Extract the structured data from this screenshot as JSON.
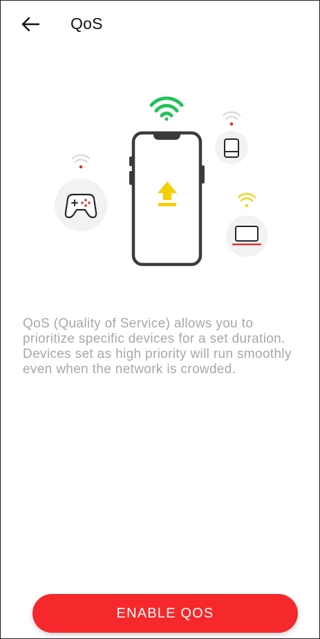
{
  "header": {
    "back_icon": "arrow-left-icon",
    "title": "QoS"
  },
  "illustration": {
    "phone_wifi_color": "#21c35a",
    "upload_arrow_color": "#f6cf00",
    "low_priority_wifi_color": "#d9d9d9",
    "low_priority_dot_color": "#e03030",
    "laptop_wifi_color": "#f2d41c",
    "device_outline_color": "#3b3b3b",
    "icons": [
      "wifi-icon",
      "smartphone-icon",
      "upload-arrow-icon",
      "tablet-icon",
      "gamepad-icon",
      "laptop-icon"
    ]
  },
  "description": {
    "text": "QoS (Quality of Service) allows you to prioritize specific devices for a set duration. Devices set as high priority will run smoothly even when the network is crowded."
  },
  "actions": {
    "enable_label": "ENABLE QOS"
  },
  "colors": {
    "accent": "#f5292b",
    "text_primary": "#111111",
    "text_secondary": "#a7a7a7"
  }
}
